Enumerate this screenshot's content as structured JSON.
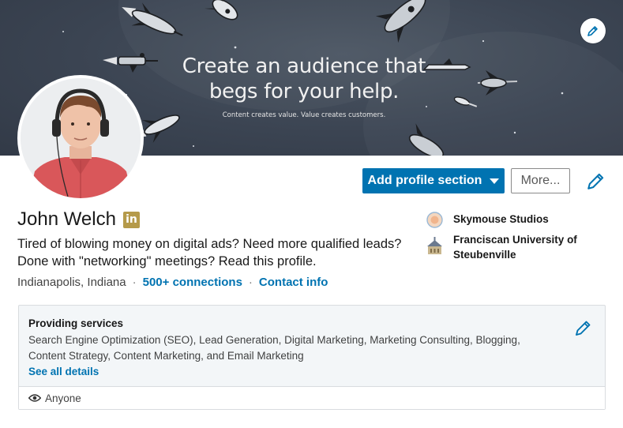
{
  "banner": {
    "headline_line1": "Create an audience that",
    "headline_line2": "begs for your help.",
    "tagline": "Content creates value. Value creates customers.",
    "edit_icon": "pencil-icon"
  },
  "profile": {
    "name": "John Welch",
    "badge": "in",
    "headline": "Tired of blowing money on digital ads? Need more qualified leads? Done with \"networking\" meetings? Read this profile.",
    "location": "Indianapolis, Indiana",
    "connections": "500+ connections",
    "contact": "Contact info"
  },
  "actions": {
    "add_section_label": "Add profile section",
    "more_label": "More..."
  },
  "organizations": [
    {
      "name": "Skymouse Studios",
      "icon": "company-logo"
    },
    {
      "name": "Franciscan University of Steubenville",
      "icon": "school-logo"
    }
  ],
  "services": {
    "title": "Providing services",
    "list": "Search Engine Optimization (SEO), Lead Generation, Digital Marketing, Marketing Consulting, Blogging, Content Strategy, Content Marketing, and Email Marketing",
    "link": "See all details",
    "visibility": "Anyone",
    "visibility_icon": "eye-icon"
  },
  "colors": {
    "accent": "#0073b1",
    "banner_bg": "#3b4452",
    "badge": "#b59a4a"
  }
}
